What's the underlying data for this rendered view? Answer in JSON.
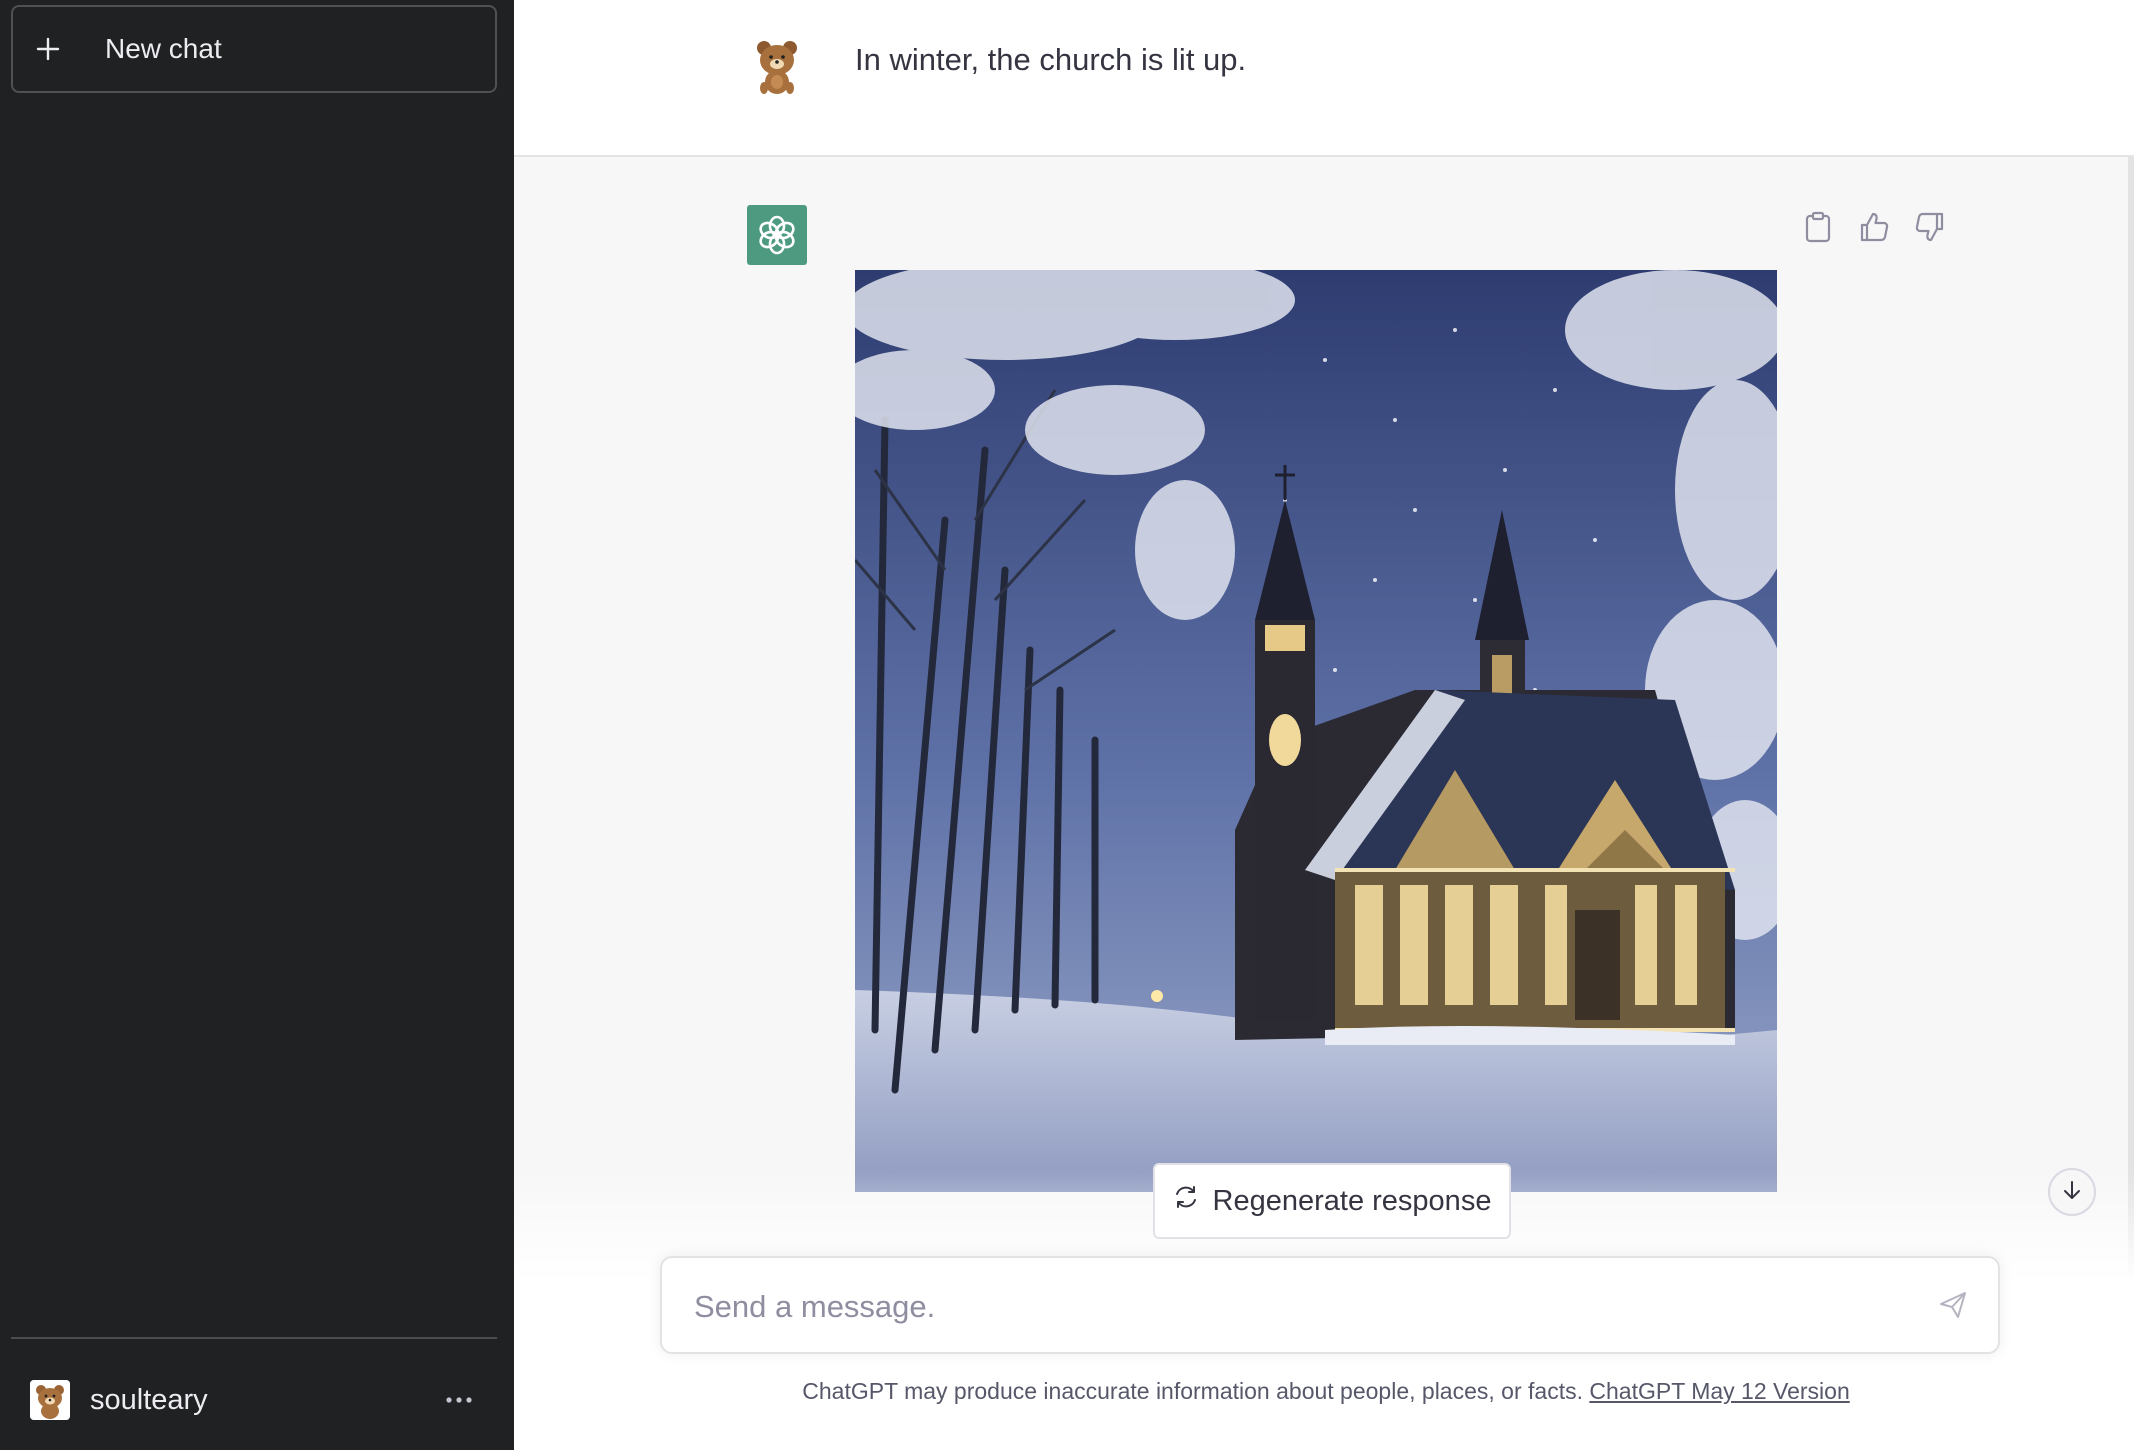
{
  "sidebar": {
    "new_chat_label": "New chat",
    "user_name": "soulteary"
  },
  "conversation": {
    "user_message": "In winter, the church is lit up.",
    "assistant_image": "church-winter-night-image"
  },
  "actions": {
    "regenerate_label": "Regenerate response"
  },
  "composer": {
    "placeholder": "Send a message."
  },
  "footer": {
    "note": "ChatGPT may produce inaccurate information about people, places, or facts.",
    "version_link": "ChatGPT May 12 Version"
  },
  "icons": [
    "plus-icon",
    "ellipsis-icon",
    "openai-logo-icon",
    "clipboard-icon",
    "thumbs-up-icon",
    "thumbs-down-icon",
    "refresh-icon",
    "arrow-down-icon",
    "send-icon"
  ],
  "colors": {
    "sidebar_bg": "#202123",
    "assistant_bg": "#f7f7f8",
    "gpt_logo_bg": "#4e9a81"
  }
}
